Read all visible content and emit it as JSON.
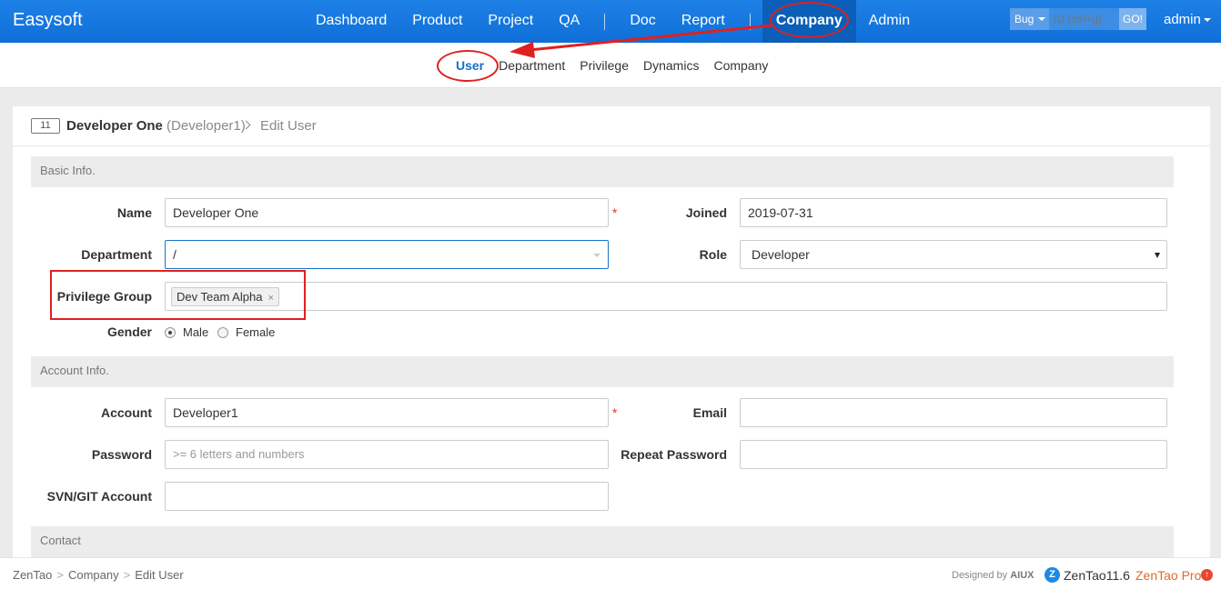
{
  "topbar": {
    "brand": "Easysoft",
    "nav": [
      {
        "label": "Dashboard"
      },
      {
        "label": "Product"
      },
      {
        "label": "Project"
      },
      {
        "label": "QA"
      },
      {
        "label": "Doc"
      },
      {
        "label": "Report"
      },
      {
        "label": "Company",
        "active": true
      },
      {
        "label": "Admin"
      }
    ],
    "search": {
      "type": "Bug",
      "placeholder": "ID (ctrl+g)",
      "go": "GO!"
    },
    "user": "admin"
  },
  "subnav": [
    {
      "label": "User",
      "active": true
    },
    {
      "label": "Department"
    },
    {
      "label": "Privilege"
    },
    {
      "label": "Dynamics"
    },
    {
      "label": "Company"
    }
  ],
  "header": {
    "id": "11",
    "name": "Developer One",
    "account": "(Developer1)",
    "action": "Edit User"
  },
  "sections": {
    "basic": "Basic Info.",
    "account": "Account Info.",
    "contact": "Contact"
  },
  "form": {
    "name": {
      "label": "Name",
      "value": "Developer One",
      "required": "*"
    },
    "joined": {
      "label": "Joined",
      "value": "2019-07-31"
    },
    "department": {
      "label": "Department",
      "value": "/"
    },
    "role": {
      "label": "Role",
      "value": "Developer"
    },
    "privilege_group": {
      "label": "Privilege Group",
      "chips": [
        "Dev Team Alpha"
      ],
      "remove": "×"
    },
    "gender": {
      "label": "Gender",
      "options": [
        "Male",
        "Female"
      ],
      "selected": "Male"
    },
    "account": {
      "label": "Account",
      "value": "Developer1",
      "required": "*"
    },
    "email": {
      "label": "Email",
      "value": ""
    },
    "password": {
      "label": "Password",
      "placeholder": ">= 6 letters and numbers"
    },
    "repeat_password": {
      "label": "Repeat Password",
      "value": ""
    },
    "svn": {
      "label": "SVN/GIT Account",
      "value": ""
    }
  },
  "footer": {
    "crumbs": [
      "ZenTao",
      "Company",
      "Edit User"
    ],
    "crumb_sep": ">",
    "designed_prefix": "Designed by",
    "designed_brand": "AIUX",
    "version": "ZenTao11.6",
    "pro": "ZenTao Pro",
    "pro_icon": "↑"
  },
  "colors": {
    "topbar": "#0f6fd8",
    "accent": "#1870c7",
    "annotation": "#e02020",
    "required": "#e53333"
  }
}
